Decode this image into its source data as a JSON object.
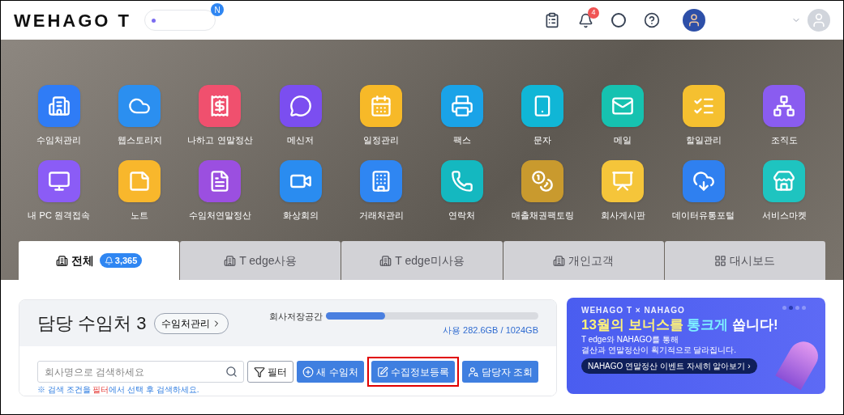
{
  "header": {
    "logo": "WEHAGO T",
    "search_badge": "N",
    "notification_count": "4"
  },
  "apps": [
    {
      "label": "수임처관리",
      "color": "#2f7cf6"
    },
    {
      "label": "웹스토리지",
      "color": "#2b8ff0"
    },
    {
      "label": "나하고 연말정산",
      "color": "#f0506e"
    },
    {
      "label": "메신저",
      "color": "#7b4ef0"
    },
    {
      "label": "일정관리",
      "color": "#f7b928"
    },
    {
      "label": "팩스",
      "color": "#1aa3e8"
    },
    {
      "label": "문자",
      "color": "#10b6d6"
    },
    {
      "label": "메일",
      "color": "#16c2b0"
    },
    {
      "label": "할일관리",
      "color": "#f5c030"
    },
    {
      "label": "조직도",
      "color": "#8a5cf0"
    },
    {
      "label": "내 PC 원격접속",
      "color": "#8b5cf6"
    },
    {
      "label": "노트",
      "color": "#f8b72c"
    },
    {
      "label": "수임처연말정산",
      "color": "#9b4fe0"
    },
    {
      "label": "화상회의",
      "color": "#2a8cf0"
    },
    {
      "label": "거래처관리",
      "color": "#2f86f2"
    },
    {
      "label": "연락처",
      "color": "#14b8c0"
    },
    {
      "label": "매출채권팩토링",
      "color": "#c99a2e"
    },
    {
      "label": "회사게시판",
      "color": "#f5c53a"
    },
    {
      "label": "데이터유통포털",
      "color": "#2f80f0"
    },
    {
      "label": "서비스마켓",
      "color": "#1ec4c0"
    }
  ],
  "tabs": [
    {
      "label": "전체",
      "count": "3,365",
      "selected": true
    },
    {
      "label": "T edge사용",
      "selected": false
    },
    {
      "label": "T edge미사용",
      "selected": false
    },
    {
      "label": "개인고객",
      "selected": false
    },
    {
      "label": "대시보드",
      "selected": false
    }
  ],
  "clients": {
    "title": "담당 수임처 3",
    "manage_link": "수임처관리",
    "storage": {
      "label": "회사저장공간",
      "level": 0.28,
      "usage": "사용 282.6GB / 1024GB"
    },
    "search": {
      "placeholder": "회사명으로 검색하세요"
    },
    "buttons": [
      {
        "label": "필터",
        "kind": "filter",
        "highlighted": false
      },
      {
        "label": "새 수임처",
        "kind": "add",
        "highlighted": false
      },
      {
        "label": "수집정보등록",
        "kind": "edit",
        "highlighted": true
      },
      {
        "label": "담당자 조회",
        "kind": "person",
        "highlighted": false
      }
    ],
    "hint": [
      {
        "text": "※ 검색 조건을 ",
        "emphasized": false
      },
      {
        "text": "필터",
        "emphasized": true
      },
      {
        "text": "에서 선택 후 검색하세요.",
        "emphasized": false
      }
    ]
  },
  "banner": {
    "logo": "WEHAGO T × NAHAGO",
    "headline": [
      {
        "text": "13월의 보너스를 ",
        "color": "#fff27a"
      },
      {
        "text": "통크게",
        "color": "#7df0ff"
      },
      {
        "text": " 쏩니다!",
        "color": "#ffffff"
      }
    ],
    "body": [
      "T edge와 NAHAGO를 통해",
      "결산과 연말정산이 획기적으로 달라집니다."
    ],
    "cta": "NAHAGO 연말정산 이벤트 자세히 알아보기 ›"
  }
}
